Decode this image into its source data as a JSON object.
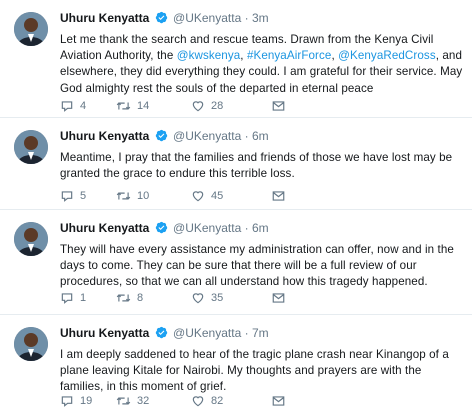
{
  "colors": {
    "link": "#1b95e0",
    "secondary_text": "#657786",
    "verified": "#1da1f2",
    "divider": "#e6ecf0"
  },
  "tweets": [
    {
      "name": "Uhuru Kenyatta",
      "handle": "@UKenyatta",
      "dot": "·",
      "time": "3m",
      "text_parts": [
        {
          "t": "Let me thank the search and rescue teams. Drawn from the Kenya Civil Aviation Authority, the ",
          "link": false
        },
        {
          "t": "@kwskenya",
          "link": true
        },
        {
          "t": ", ",
          "link": false
        },
        {
          "t": "#KenyaAirForce",
          "link": true
        },
        {
          "t": ", ",
          "link": false
        },
        {
          "t": "@KenyaRedCross",
          "link": true
        },
        {
          "t": ", and elsewhere, they did everything they could. I am grateful for their service. May God almighty rest the souls of the departed in eternal peace",
          "link": false
        }
      ],
      "replies": "4",
      "retweets": "14",
      "likes": "28"
    },
    {
      "name": "Uhuru Kenyatta",
      "handle": "@UKenyatta",
      "dot": "·",
      "time": "6m",
      "text_parts": [
        {
          "t": "Meantime, I pray that the families and friends of those we have lost may be granted the grace to endure this terrible loss.",
          "link": false
        }
      ],
      "replies": "5",
      "retweets": "10",
      "likes": "45"
    },
    {
      "name": "Uhuru Kenyatta",
      "handle": "@UKenyatta",
      "dot": "·",
      "time": "6m",
      "text_parts": [
        {
          "t": "They will have every assistance my administration can offer, now and in the days to come. They can be sure that there will be a full review of our procedures, so that we can all understand how this tragedy happened.",
          "link": false
        }
      ],
      "replies": "1",
      "retweets": "8",
      "likes": "35"
    },
    {
      "name": "Uhuru Kenyatta",
      "handle": "@UKenyatta",
      "dot": "·",
      "time": "7m",
      "text_parts": [
        {
          "t": "I am deeply saddened to hear of the tragic plane crash near Kinangop of a plane leaving Kitale for Nairobi. My thoughts and prayers are with the families, in this moment of grief.",
          "link": false
        }
      ],
      "replies": "19",
      "retweets": "32",
      "likes": "82"
    }
  ]
}
